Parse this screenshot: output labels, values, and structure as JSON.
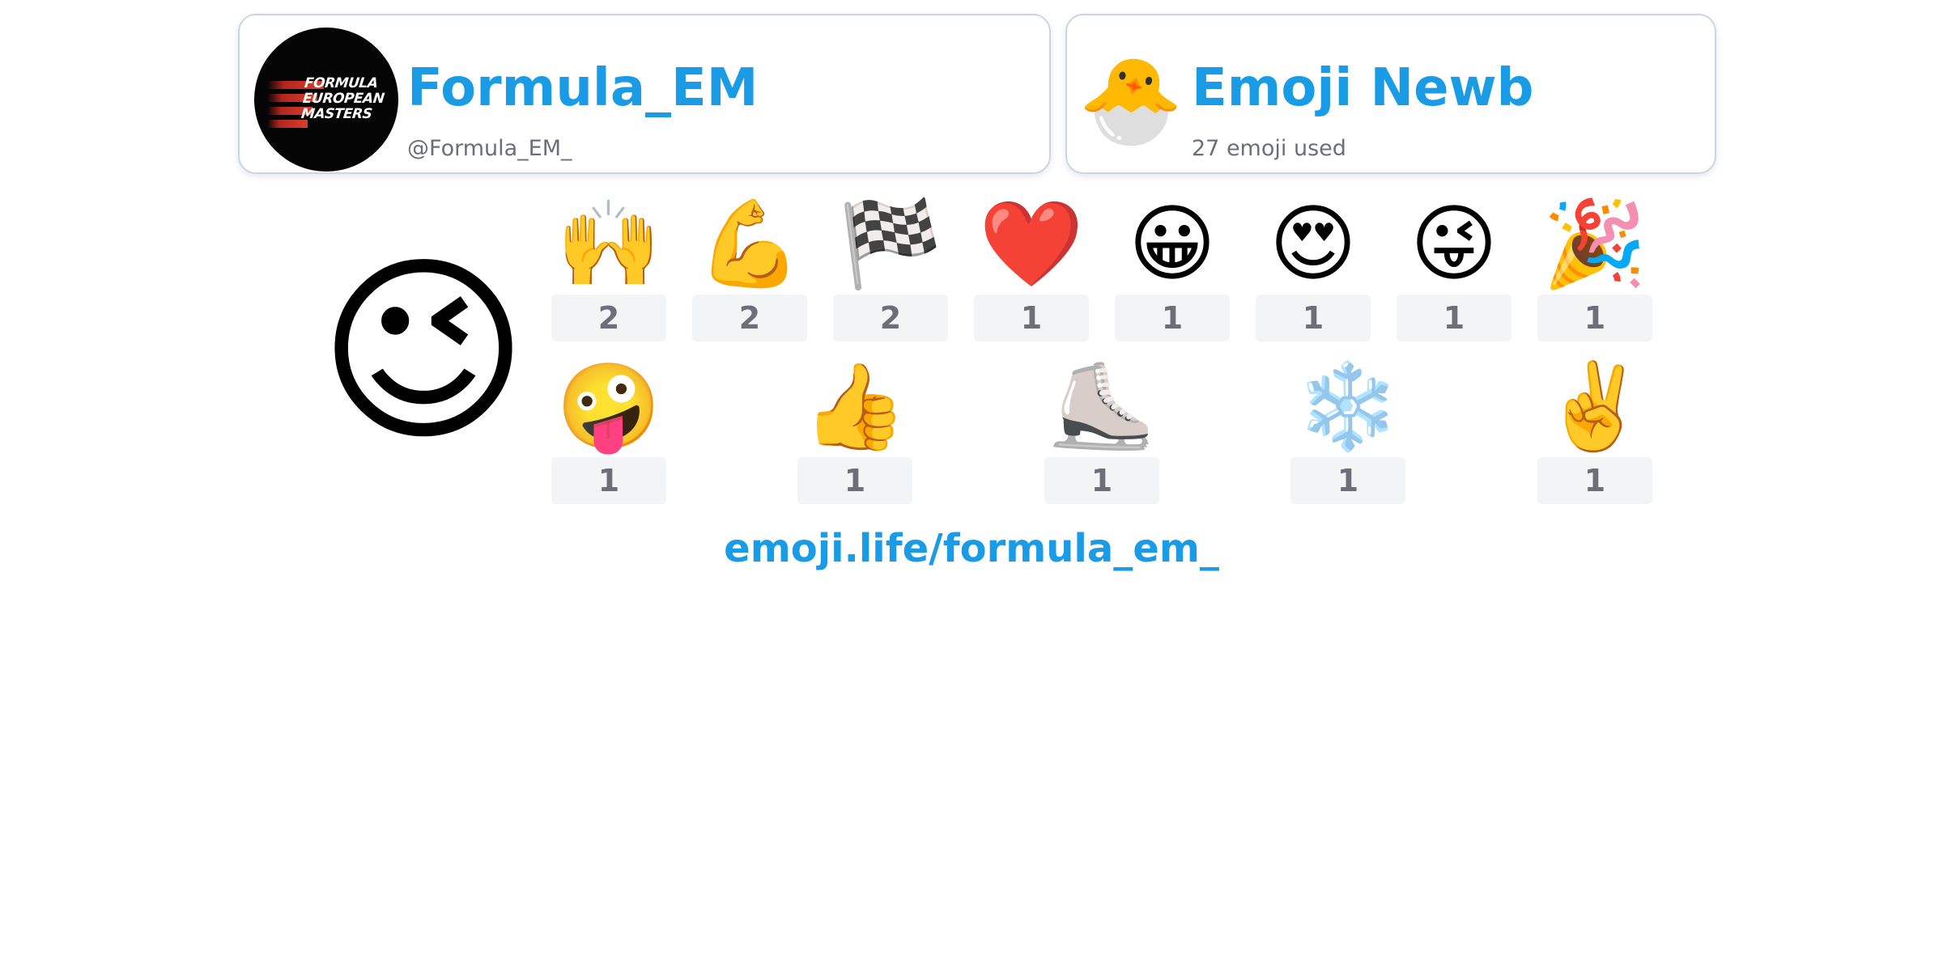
{
  "profile": {
    "name": "Formula_EM",
    "handle": "@Formula_EM_",
    "avatar_logo_lines": [
      "FORMULA",
      "EUROPEAN",
      "MASTERS"
    ]
  },
  "rank": {
    "emoji": "🐣",
    "title": "Emoji Newb",
    "subtitle": "27 emoji used"
  },
  "top_emoji": "😉",
  "emoji_counts": [
    {
      "emoji": "🙌",
      "count": "2"
    },
    {
      "emoji": "💪",
      "count": "2"
    },
    {
      "emoji": "🏁",
      "count": "2"
    },
    {
      "emoji": "❤️",
      "count": "1"
    },
    {
      "emoji": "😀",
      "count": "1"
    },
    {
      "emoji": "😍",
      "count": "1"
    },
    {
      "emoji": "😜",
      "count": "1"
    },
    {
      "emoji": "🎉",
      "count": "1"
    },
    {
      "emoji": "🤪",
      "count": "1"
    },
    {
      "emoji": "👍",
      "count": "1"
    },
    {
      "emoji": "⛸️",
      "count": "1"
    },
    {
      "emoji": "❄️",
      "count": "1"
    },
    {
      "emoji": "✌️",
      "count": "1"
    }
  ],
  "share_link": "emoji.life/formula_em_",
  "colors": {
    "accent": "#1a9be6",
    "muted_text": "#6c6f78",
    "count_background": "#f3f4f6",
    "card_border": "#cdd4e3",
    "avatar_background": "#050505",
    "avatar_stripes": "#d43b2c"
  }
}
